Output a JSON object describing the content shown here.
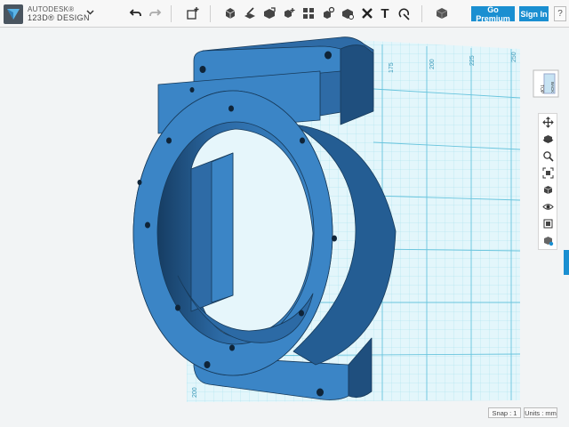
{
  "app": {
    "brand_line1": "AUTODESK®",
    "brand_line2": "123D® DESIGN",
    "logo_icon": "123d-logo-icon",
    "menu_icon": "chevron-down-icon"
  },
  "toolbar": {
    "undo_icon": "undo-icon",
    "redo_icon": "redo-icon",
    "tools": [
      {
        "name": "primitives-tool",
        "icon": "add-shape-icon"
      },
      {
        "name": "sketch-tool",
        "icon": "sketch-cube-icon"
      },
      {
        "name": "construct-tool",
        "icon": "construct-icon"
      },
      {
        "name": "modify-tool",
        "icon": "modify-icon"
      },
      {
        "name": "pattern-tool",
        "icon": "pattern-icon"
      },
      {
        "name": "group-tool",
        "icon": "group-icon"
      },
      {
        "name": "combine-tool",
        "icon": "combine-icon"
      },
      {
        "name": "measure-tool",
        "icon": "measure-icon"
      },
      {
        "name": "text-tool",
        "icon": "text-icon"
      },
      {
        "name": "snap-tool",
        "icon": "snap-icon"
      },
      {
        "name": "material-tool",
        "icon": "material-icon"
      }
    ],
    "text_glyph": "T",
    "go_premium": "Go Premium",
    "sign_in": "Sign In",
    "help": "?"
  },
  "viewcube": {
    "face_top": "TOP",
    "face_back": "BACK"
  },
  "navbar": {
    "items": [
      "pan-icon",
      "orbit-icon",
      "zoom-icon",
      "fit-icon",
      "views-icon",
      "visibility-icon",
      "hide-icon",
      "material-view-icon"
    ]
  },
  "grid": {
    "ruler_top": [
      "175",
      "200",
      "225",
      "250"
    ],
    "ruler_bottom": "200"
  },
  "status": {
    "snap": "Snap : 1",
    "units": "Units : mm"
  },
  "colors": {
    "accent": "#1a8fd1",
    "model": "#3b85c6",
    "model_dark": "#1f4f7e",
    "grid": "#8fd3e6"
  }
}
